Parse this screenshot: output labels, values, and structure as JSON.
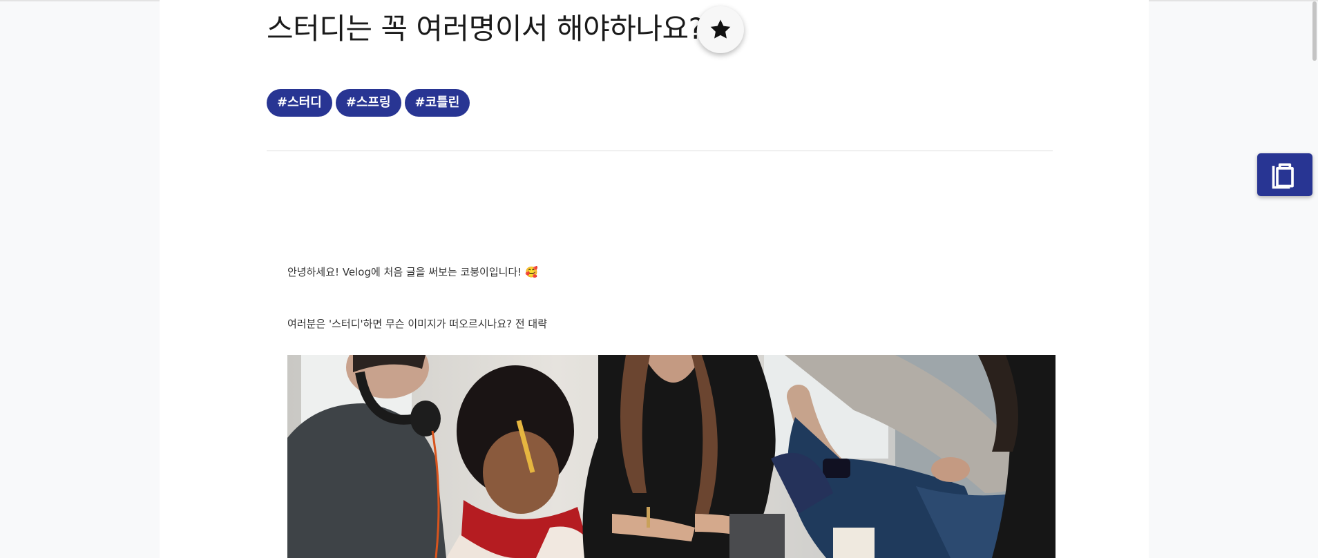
{
  "post": {
    "title": "스터디는 꼭 여러명이서 해야하나요?",
    "tags": [
      "#스터디",
      "#스프링",
      "#코틀린"
    ],
    "paragraphs": [
      "안녕하세요! Velog에 처음 글을 써보는 코붕이입니다! 🥰",
      "여러분은 '스터디'하면 무슨 이미지가 떠오르시나요? 전 대략"
    ]
  },
  "icons": {
    "star": "star-icon",
    "clipboard": "clipboard-icon"
  },
  "colors": {
    "accent": "#283593",
    "page_background": "#ffffff",
    "outer_background": "#f8f9fa"
  }
}
